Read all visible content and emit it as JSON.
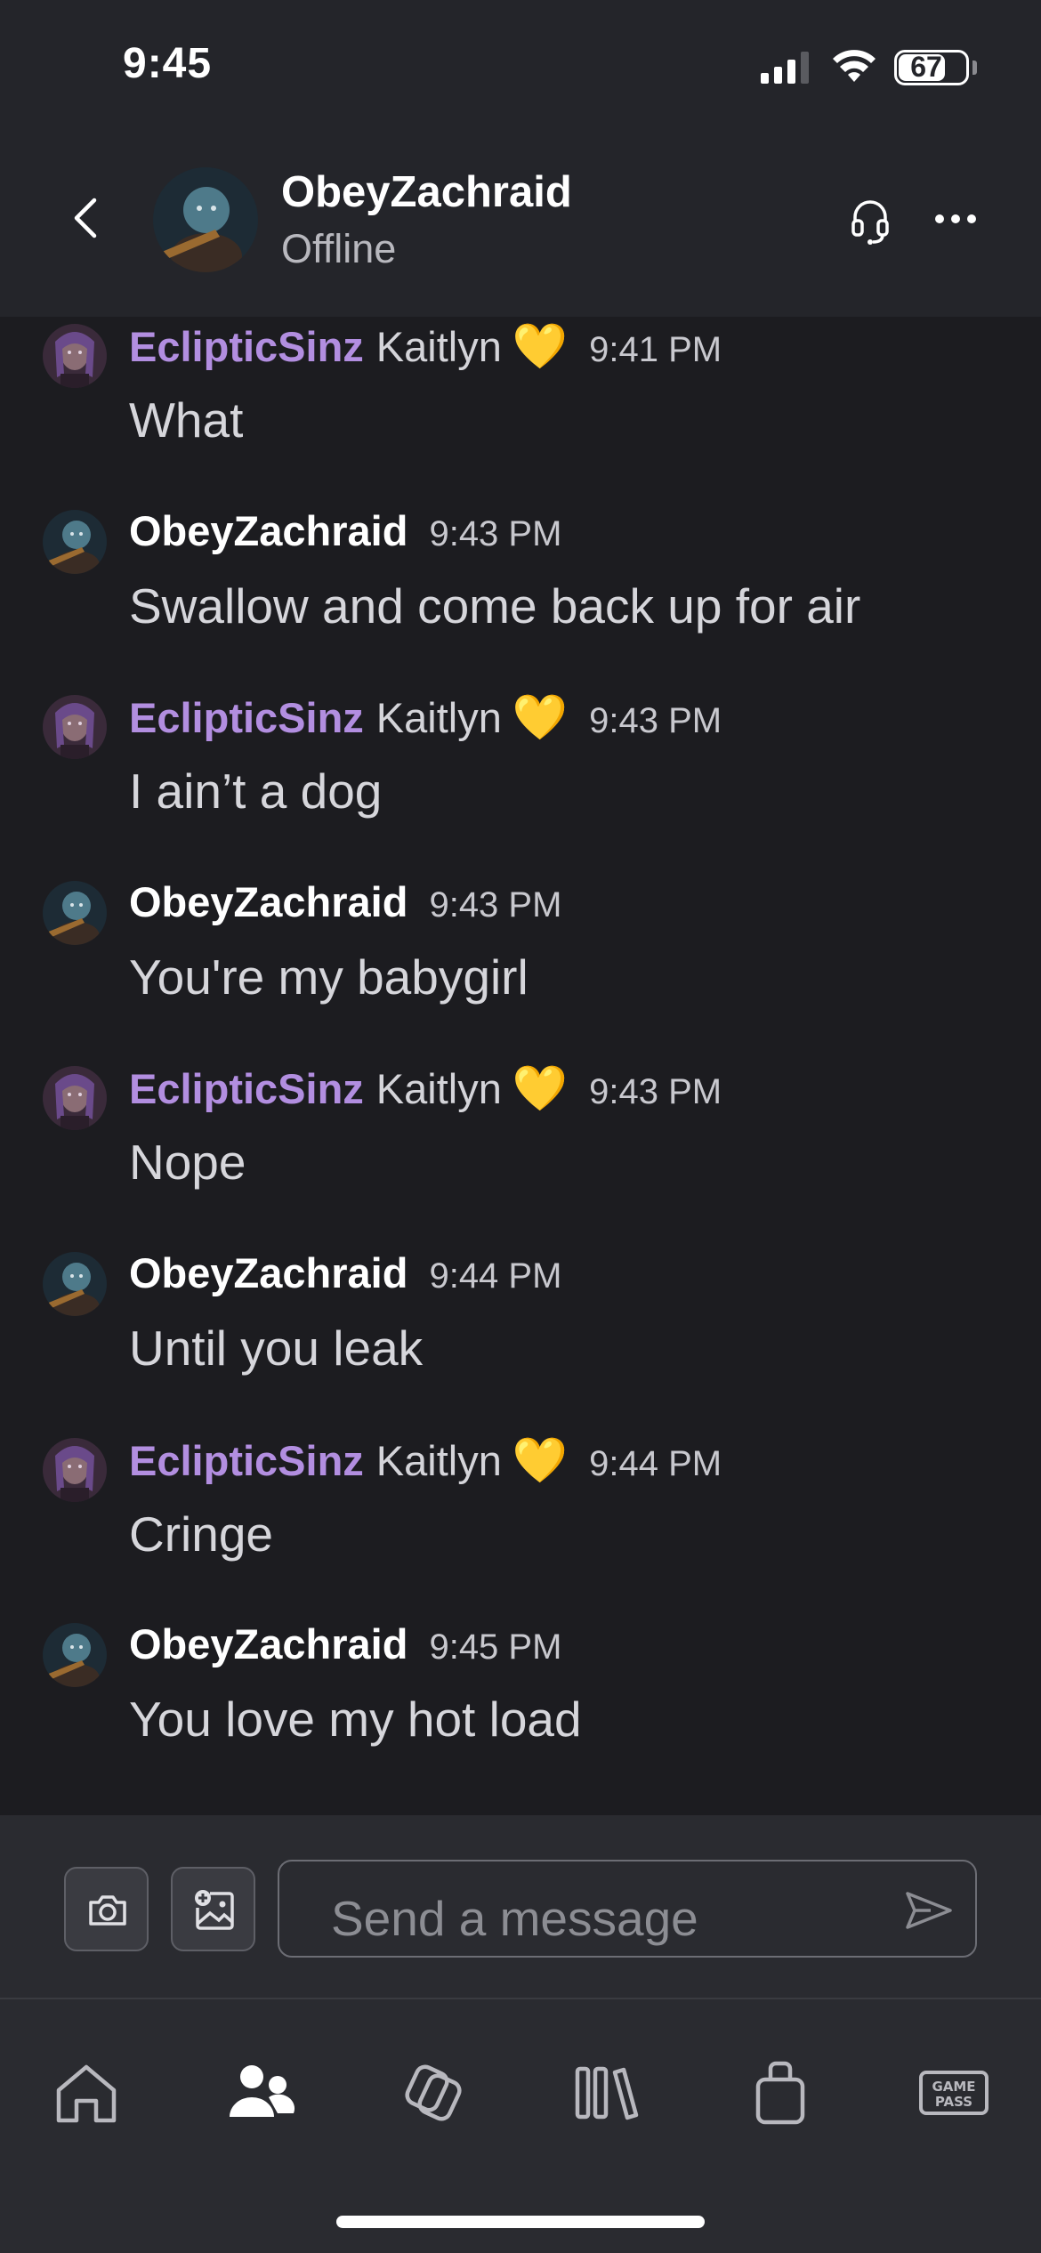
{
  "status_bar": {
    "time": "9:45",
    "battery": "67"
  },
  "header": {
    "name": "ObeyZachraid",
    "status": "Offline"
  },
  "messages": [
    {
      "sender": "EclipticSinz",
      "real_name": "Kaitlyn",
      "emoji": "💛",
      "time": "9:41 PM",
      "text": "What"
    },
    {
      "sender": "ObeyZachraid",
      "real_name": "",
      "emoji": "",
      "time": "9:43 PM",
      "text": "Swallow and come back up for air"
    },
    {
      "sender": "EclipticSinz",
      "real_name": "Kaitlyn",
      "emoji": "💛",
      "time": "9:43 PM",
      "text": "I ain’t a dog"
    },
    {
      "sender": "ObeyZachraid",
      "real_name": "",
      "emoji": "",
      "time": "9:43 PM",
      "text": "You're my babygirl"
    },
    {
      "sender": "EclipticSinz",
      "real_name": "Kaitlyn",
      "emoji": "💛",
      "time": "9:43 PM",
      "text": "Nope"
    },
    {
      "sender": "ObeyZachraid",
      "real_name": "",
      "emoji": "",
      "time": "9:44 PM",
      "text": "Until you leak"
    },
    {
      "sender": "EclipticSinz",
      "real_name": "Kaitlyn",
      "emoji": "💛",
      "time": "9:44 PM",
      "text": "Cringe"
    },
    {
      "sender": "ObeyZachraid",
      "real_name": "",
      "emoji": "",
      "time": "9:45 PM",
      "text": "You love my hot load"
    }
  ],
  "composer": {
    "placeholder": "Send a message"
  },
  "bottom_nav": {
    "game_pass_line1": "GAME",
    "game_pass_line2": "PASS"
  },
  "colors": {
    "eclipticsinz_name": "#b28ee0",
    "background": "#1c1c20",
    "header_bg": "#24252a"
  },
  "icons": [
    "back-chevron-icon",
    "headset-icon",
    "more-icon",
    "camera-icon",
    "add-image-icon",
    "send-icon",
    "home-icon",
    "friends-icon",
    "social-icon",
    "library-icon",
    "store-icon",
    "game-pass-icon"
  ]
}
